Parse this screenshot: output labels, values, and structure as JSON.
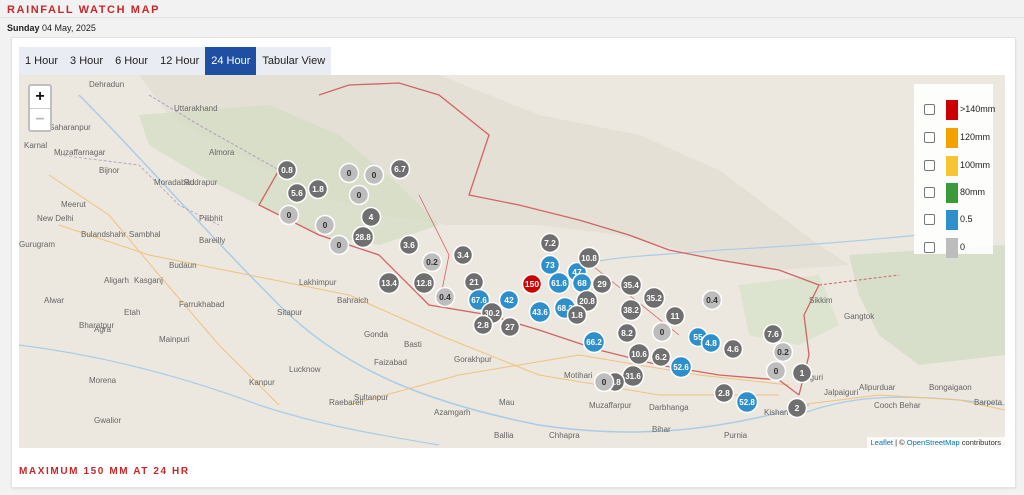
{
  "page": {
    "title": "RAINFALL WATCH MAP",
    "day": "Sunday",
    "date": "04 May, 2025",
    "max_label": "MAXIMUM 150 MM AT 24 HR"
  },
  "tabs": [
    {
      "label": "1 Hour",
      "active": false
    },
    {
      "label": "3 Hour",
      "active": false
    },
    {
      "label": "6 Hour",
      "active": false
    },
    {
      "label": "12 Hour",
      "active": false
    },
    {
      "label": "24 Hour",
      "active": true
    },
    {
      "label": "Tabular View",
      "active": false
    }
  ],
  "map": {
    "zoom_in": "+",
    "zoom_out": "−",
    "attribution": {
      "leaflet": "Leaflet",
      "sep": " | © ",
      "osm": "OpenStreetMap",
      "suffix": " contributors"
    },
    "legend": [
      {
        "label": ">140mm",
        "color": "#cc0000"
      },
      {
        "label": "120mm",
        "color": "#f5a100"
      },
      {
        "label": "100mm",
        "color": "#f7c531"
      },
      {
        "label": "80mm",
        "color": "#3b9b3b"
      },
      {
        "label": "0.5",
        "color": "#2f8fcb"
      },
      {
        "label": "0",
        "color": "#bdbdbd"
      }
    ],
    "place_labels": [
      "Dehradun",
      "Saharanpur",
      "Muzaffarnagar",
      "Meerut",
      "New Delhi",
      "Gurugram",
      "Bulandshahr",
      "Sambhal",
      "Bareilly",
      "Budaun",
      "Moradabad",
      "Rudrapur",
      "Pilibhit",
      "Lakhimpur",
      "Bahraich",
      "Sitapur",
      "Lucknow",
      "Gonda",
      "Faizabad",
      "Gorakhpur",
      "Basti",
      "Kanpur",
      "Raebareli",
      "Sultanpur",
      "Azamgarh",
      "Mau",
      "Ballia",
      "Chhapra",
      "Muzaffarpur",
      "Darbhanga",
      "Motihari",
      "Purnia",
      "Kishan",
      "Siliguri",
      "Jalpaiguri",
      "Alipurduar",
      "Bongaigaon",
      "Cooch Behar",
      "Gangtok",
      "Sikkim",
      "Agra",
      "Mainpuri",
      "Morena",
      "Gwalior",
      "Bharatpur",
      "Alwar",
      "Karnal",
      "Almora",
      "Bijnor",
      "Kasganj",
      "Farrukhabad",
      "Etah",
      "Aligarh",
      "Bihar",
      "Uttarakhand",
      "Barpeta"
    ],
    "markers": [
      {
        "v": "0.8",
        "c": "gray"
      },
      {
        "v": "5.6",
        "c": "gray"
      },
      {
        "v": "1.8",
        "c": "gray"
      },
      {
        "v": "6.7",
        "c": "gray"
      },
      {
        "v": "0",
        "c": "lgray"
      },
      {
        "v": "0",
        "c": "lgray"
      },
      {
        "v": "0",
        "c": "lgray"
      },
      {
        "v": "0",
        "c": "lgray"
      },
      {
        "v": "4",
        "c": "gray"
      },
      {
        "v": "28.8",
        "c": "gray"
      },
      {
        "v": "0",
        "c": "lgray"
      },
      {
        "v": "0",
        "c": "lgray"
      },
      {
        "v": "3.6",
        "c": "gray"
      },
      {
        "v": "0.2",
        "c": "lgray"
      },
      {
        "v": "3.4",
        "c": "gray"
      },
      {
        "v": "13.4",
        "c": "gray"
      },
      {
        "v": "12.8",
        "c": "gray"
      },
      {
        "v": "0.4",
        "c": "lgray"
      },
      {
        "v": "21",
        "c": "gray"
      },
      {
        "v": "67.6",
        "c": "blue"
      },
      {
        "v": "30.2",
        "c": "gray"
      },
      {
        "v": "42",
        "c": "blue"
      },
      {
        "v": "27",
        "c": "gray"
      },
      {
        "v": "2.8",
        "c": "gray"
      },
      {
        "v": "7.2",
        "c": "gray"
      },
      {
        "v": "73",
        "c": "blue"
      },
      {
        "v": "150",
        "c": "red"
      },
      {
        "v": "61.6",
        "c": "blue"
      },
      {
        "v": "47",
        "c": "blue"
      },
      {
        "v": "68",
        "c": "blue"
      },
      {
        "v": "10.8",
        "c": "gray"
      },
      {
        "v": "43.6",
        "c": "blue"
      },
      {
        "v": "68.2",
        "c": "blue"
      },
      {
        "v": "20.8",
        "c": "gray"
      },
      {
        "v": "1.8",
        "c": "gray"
      },
      {
        "v": "29",
        "c": "gray"
      },
      {
        "v": "35.4",
        "c": "gray"
      },
      {
        "v": "38.2",
        "c": "gray"
      },
      {
        "v": "35.2",
        "c": "gray"
      },
      {
        "v": "0.4",
        "c": "lgray"
      },
      {
        "v": "11",
        "c": "gray"
      },
      {
        "v": "66.2",
        "c": "blue"
      },
      {
        "v": "8.2",
        "c": "gray"
      },
      {
        "v": "10.6",
        "c": "gray"
      },
      {
        "v": "6.2",
        "c": "gray"
      },
      {
        "v": "31.6",
        "c": "gray"
      },
      {
        "v": "7.8",
        "c": "gray"
      },
      {
        "v": "52.6",
        "c": "blue"
      },
      {
        "v": "55",
        "c": "blue"
      },
      {
        "v": "4.8",
        "c": "blue"
      },
      {
        "v": "7.6",
        "c": "gray"
      },
      {
        "v": "4.6",
        "c": "gray"
      },
      {
        "v": "0.2",
        "c": "lgray"
      },
      {
        "v": "1",
        "c": "gray"
      },
      {
        "v": "2.8",
        "c": "gray"
      },
      {
        "v": "52.8",
        "c": "blue"
      },
      {
        "v": "2",
        "c": "gray"
      },
      {
        "v": "0",
        "c": "lgray"
      },
      {
        "v": "0",
        "c": "lgray"
      },
      {
        "v": "0",
        "c": "lgray"
      }
    ],
    "marker_colors": {
      "gray": "#6f6f6f",
      "lgray": "#bdbdbd",
      "blue": "#2f8fcb",
      "red": "#cc0000"
    }
  }
}
